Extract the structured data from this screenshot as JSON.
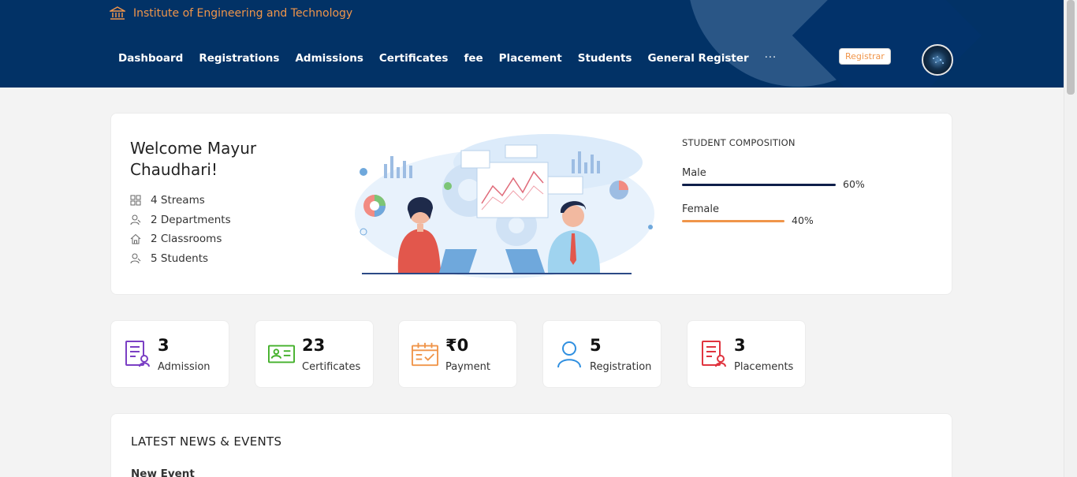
{
  "brand": {
    "title": "Institute of Engineering and Technology",
    "icon": "institution-icon",
    "color": "#f0954a"
  },
  "nav": {
    "items": [
      {
        "label": "Dashboard"
      },
      {
        "label": "Registrations"
      },
      {
        "label": "Admissions"
      },
      {
        "label": "Certificates"
      },
      {
        "label": "fee"
      },
      {
        "label": "Placement"
      },
      {
        "label": "Students"
      },
      {
        "label": "General Register"
      }
    ],
    "more": "···"
  },
  "user": {
    "role": "Registrar",
    "avatar_icon": "user-avatar"
  },
  "welcome": {
    "title": "Welcome Mayur Chaudhari!",
    "stats": [
      {
        "icon": "grid-icon",
        "text": "4 Streams"
      },
      {
        "icon": "users-icon",
        "text": "2 Departments"
      },
      {
        "icon": "home-icon",
        "text": "2 Classrooms"
      },
      {
        "icon": "users-icon",
        "text": "5 Students"
      }
    ]
  },
  "composition": {
    "heading": "STUDENT COMPOSITION",
    "rows": [
      {
        "label": "Male",
        "percent": 60,
        "percent_text": "60%",
        "color": "#0f1f4a"
      },
      {
        "label": "Female",
        "percent": 40,
        "percent_text": "40%",
        "color": "#f0954a"
      }
    ]
  },
  "cards": [
    {
      "value": "3",
      "label": "Admission",
      "icon": "admission-icon",
      "color": "#7b3fc4"
    },
    {
      "value": "23",
      "label": "Certificates",
      "icon": "certificate-icon",
      "color": "#43b02a"
    },
    {
      "value": "₹0",
      "label": "Payment",
      "icon": "calendar-check-icon",
      "color": "#f0954a"
    },
    {
      "value": "5",
      "label": "Registration",
      "icon": "user-icon",
      "color": "#2f8fe0"
    },
    {
      "value": "3",
      "label": "Placements",
      "icon": "placement-icon",
      "color": "#e0343f"
    }
  ],
  "news": {
    "heading": "LATEST NEWS & EVENTS",
    "first_event": "New Event"
  },
  "colors": {
    "header_bg": "#023266",
    "page_bg": "#f3f3f3"
  }
}
